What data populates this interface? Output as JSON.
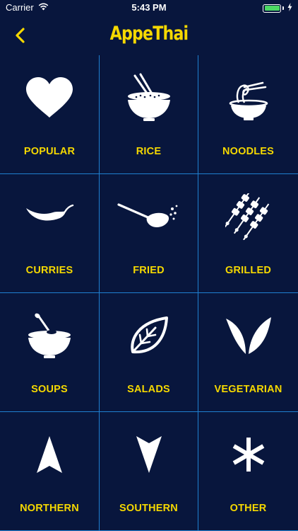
{
  "status_bar": {
    "carrier": "Carrier",
    "time": "5:43 PM"
  },
  "header": {
    "title": "AppeThai",
    "back_icon": "chevron-left-icon"
  },
  "colors": {
    "background": "#08163d",
    "accent": "#f5d800",
    "grid_line": "#1f7fd0",
    "icon": "#ffffff"
  },
  "categories": [
    {
      "label": "POPULAR",
      "icon": "heart-icon"
    },
    {
      "label": "RICE",
      "icon": "rice-bowl-icon"
    },
    {
      "label": "NOODLES",
      "icon": "noodle-bowl-icon"
    },
    {
      "label": "CURRIES",
      "icon": "chili-pepper-icon"
    },
    {
      "label": "FRIED",
      "icon": "frying-spoon-icon"
    },
    {
      "label": "GRILLED",
      "icon": "skewers-icon"
    },
    {
      "label": "SOUPS",
      "icon": "soup-bowl-icon"
    },
    {
      "label": "SALADS",
      "icon": "leaf-icon"
    },
    {
      "label": "VEGETARIAN",
      "icon": "sprout-icon"
    },
    {
      "label": "NORTHERN",
      "icon": "arrow-up-icon"
    },
    {
      "label": "SOUTHERN",
      "icon": "arrow-down-icon"
    },
    {
      "label": "OTHER",
      "icon": "asterisk-icon"
    }
  ]
}
